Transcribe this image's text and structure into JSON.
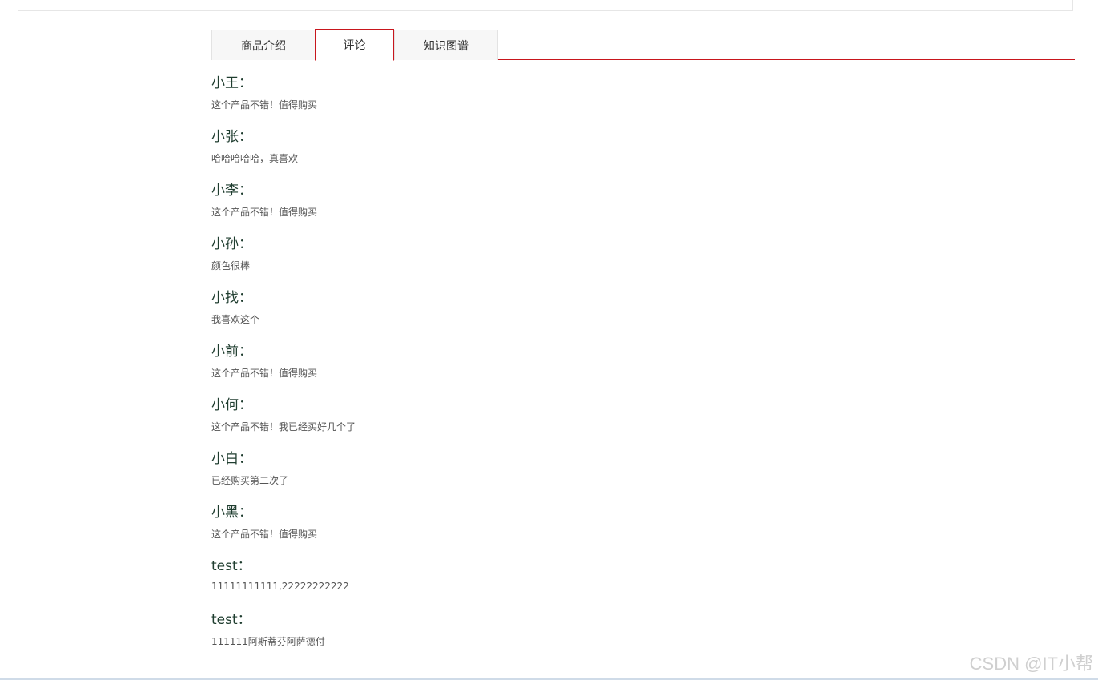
{
  "tabs": [
    {
      "label": "商品介绍",
      "active": false
    },
    {
      "label": "评论",
      "active": true
    },
    {
      "label": "知识图谱",
      "active": false
    }
  ],
  "comments": [
    {
      "user": "小王：",
      "text": "这个产品不错！值得购买"
    },
    {
      "user": "小张：",
      "text": "哈哈哈哈哈，真喜欢"
    },
    {
      "user": "小李：",
      "text": "这个产品不错！值得购买"
    },
    {
      "user": "小孙：",
      "text": "颜色很棒"
    },
    {
      "user": "小找：",
      "text": "我喜欢这个"
    },
    {
      "user": "小前：",
      "text": "这个产品不错！值得购买"
    },
    {
      "user": "小何：",
      "text": "这个产品不错！我已经买好几个了"
    },
    {
      "user": "小白：",
      "text": "已经购买第二次了"
    },
    {
      "user": "小黑：",
      "text": "这个产品不错！值得购买"
    },
    {
      "user": "test：",
      "text": "11111111111,22222222222"
    },
    {
      "user": "test：",
      "text": "111111阿斯蒂芬阿萨德付"
    }
  ],
  "watermark": "CSDN @IT小帮",
  "colors": {
    "accent": "#c8161d",
    "username": "#1f3d2f",
    "comment_text": "#555555"
  }
}
